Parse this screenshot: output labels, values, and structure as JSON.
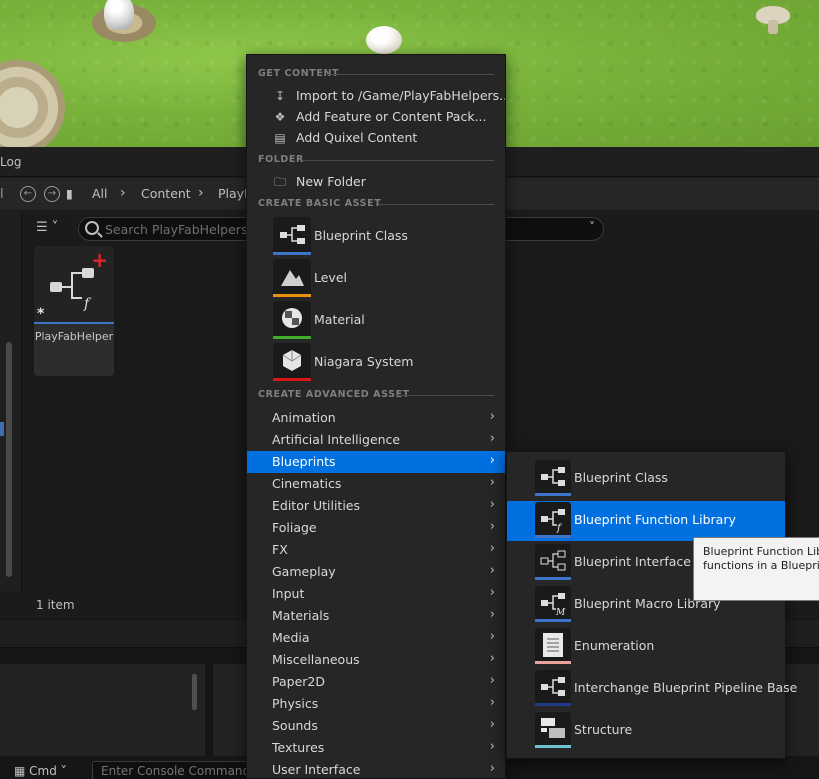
{
  "browser": {
    "tab_label": "Log",
    "path": {
      "root": "All",
      "content": "Content",
      "folder": "PlayF"
    },
    "search": {
      "placeholder": "Search PlayFabHelpers"
    },
    "asset": {
      "name": "PlayFabHelper"
    },
    "item_count": "1 item"
  },
  "console": {
    "cmd_label": "Cmd",
    "placeholder": "Enter Console Command"
  },
  "menu": {
    "sections": {
      "get_content": "GET CONTENT",
      "folder": "FOLDER",
      "basic": "CREATE BASIC ASSET",
      "advanced": "CREATE ADVANCED ASSET"
    },
    "get_content_items": [
      {
        "label": "Import to /Game/PlayFabHelpers...",
        "icon": "import-icon"
      },
      {
        "label": "Add Feature or Content Pack...",
        "icon": "feature-pack-icon"
      },
      {
        "label": "Add Quixel Content",
        "icon": "quixel-icon"
      }
    ],
    "folder_items": [
      {
        "label": "New Folder",
        "icon": "new-folder-icon"
      }
    ],
    "basic_items": [
      {
        "label": "Blueprint Class",
        "color": "#3d74c7"
      },
      {
        "label": "Level",
        "color": "#e8930e"
      },
      {
        "label": "Material",
        "color": "#3fae2a"
      },
      {
        "label": "Niagara System",
        "color": "#d91616"
      }
    ],
    "advanced_items": [
      "Animation",
      "Artificial Intelligence",
      "Blueprints",
      "Cinematics",
      "Editor Utilities",
      "Foliage",
      "FX",
      "Gameplay",
      "Input",
      "Materials",
      "Media",
      "Miscellaneous",
      "Paper2D",
      "Physics",
      "Sounds",
      "Textures",
      "User Interface"
    ],
    "active_advanced": "Blueprints"
  },
  "submenu": {
    "items": [
      {
        "label": "Blueprint Class",
        "color": "#3d74c7"
      },
      {
        "label": "Blueprint Function Library",
        "color": "#3d74c7"
      },
      {
        "label": "Blueprint Interface",
        "color": "#3d74c7"
      },
      {
        "label": "Blueprint Macro Library",
        "color": "#3d74c7"
      },
      {
        "label": "Enumeration",
        "color": "#e8a29a"
      },
      {
        "label": "Interchange Blueprint Pipeline Base",
        "color": "#1f3a8a"
      },
      {
        "label": "Structure",
        "color": "#6ec3cf"
      }
    ],
    "active": "Blueprint Function Library"
  },
  "tooltip": {
    "line1": "Blueprint Function Lib",
    "line2": "functions in a Blueprin"
  },
  "colors": {
    "accent": "#0070e0"
  }
}
